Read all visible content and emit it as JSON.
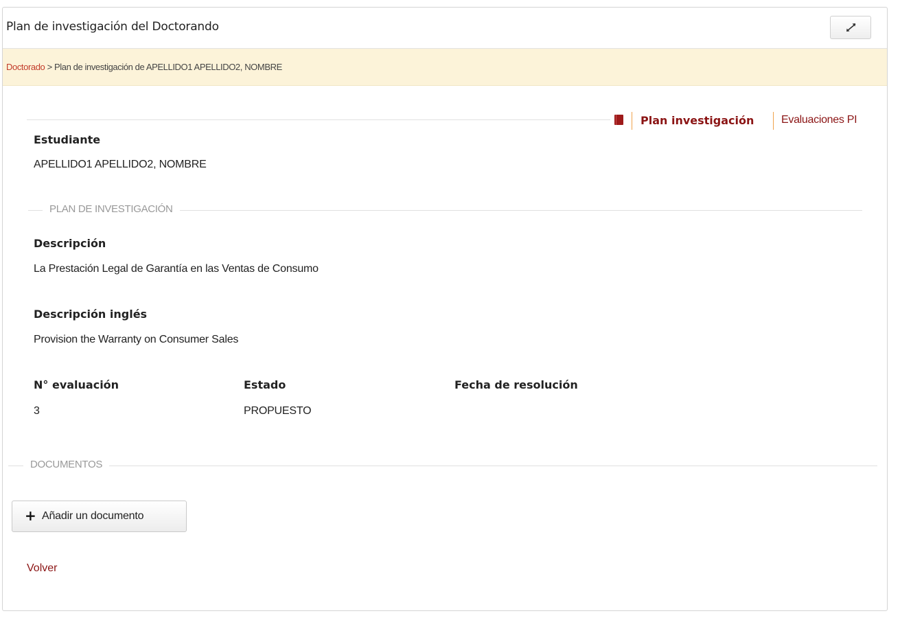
{
  "panel": {
    "title": "Plan de investigación del Doctorando",
    "expand_icon": "expand-arrows-icon"
  },
  "breadcrumb": {
    "root": "Doctorado",
    "separator": " > ",
    "current": "Plan de investigación de APELLIDO1 APELLIDO2, NOMBRE"
  },
  "nav": {
    "icon": "book-icon",
    "items": [
      {
        "label": "Plan investigación",
        "active": true
      },
      {
        "label": "Evaluaciones PI",
        "active": false
      }
    ]
  },
  "student": {
    "label": "Estudiante",
    "value": "APELLIDO1 APELLIDO2, NOMBRE"
  },
  "plan": {
    "section_title": "PLAN DE INVESTIGACIÓN",
    "descripcion_label": "Descripción",
    "descripcion_value": "La Prestación Legal de Garantía en las Ventas de Consumo",
    "descripcion_ingles_label": "Descripción inglés",
    "descripcion_ingles_value": "Provision the Warranty on Consumer Sales",
    "evaluacion_label": "N° evaluación",
    "evaluacion_value": "3",
    "estado_label": "Estado",
    "estado_value": "PROPUESTO",
    "fecha_label": "Fecha de resolución",
    "fecha_value": ""
  },
  "documentos": {
    "section_title": "DOCUMENTOS",
    "add_button_label": "Añadir un documento",
    "add_icon": "plus-icon"
  },
  "back_label": "Volver",
  "colors": {
    "link": "#8b1414",
    "breadcrumb_link": "#c23b2a",
    "breadcrumb_bg": "#fcf3d9",
    "separator": "#f0a24a"
  }
}
